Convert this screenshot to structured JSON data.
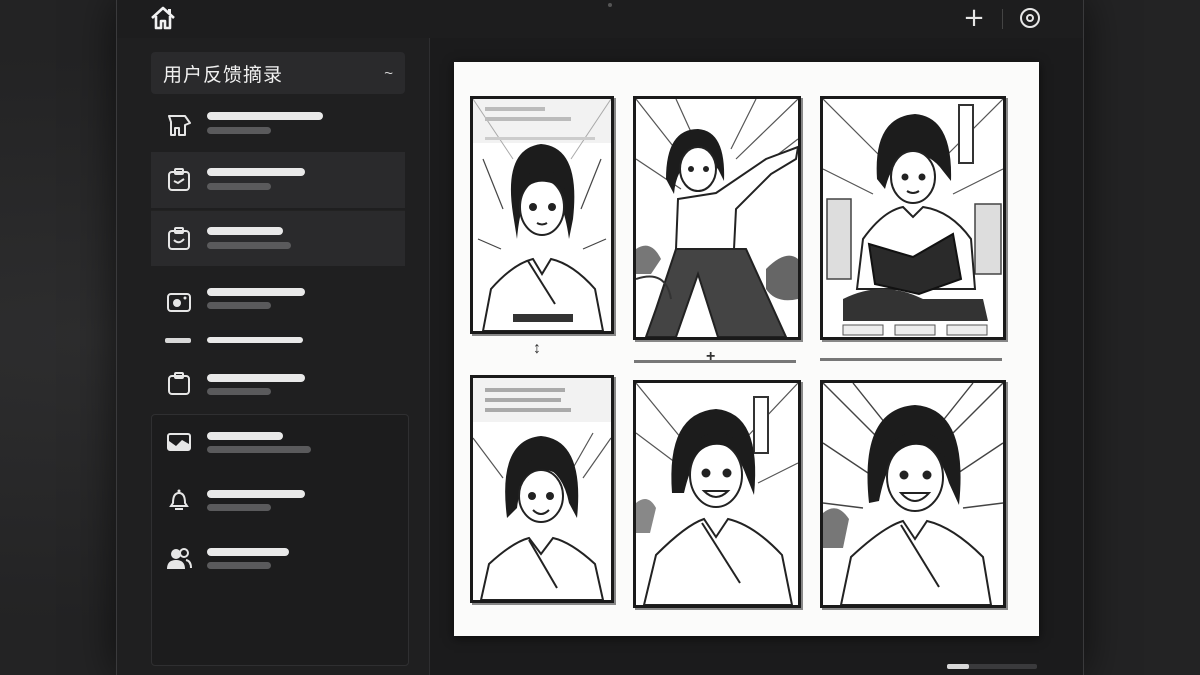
{
  "sidebar": {
    "section_title": "用户反馈摘录",
    "collapse_symbol": "~"
  },
  "topbar": {
    "icons": [
      "home-icon",
      "add-icon",
      "settings-icon"
    ],
    "add_symbol": "+"
  },
  "main": {
    "page_description_icons": [
      "storyboard-panel"
    ],
    "connector_symbol": "↕",
    "connector_plus_symbol": "+"
  },
  "colors": {
    "window_bg": "#1d1d1e",
    "sidebar_bg": "#1f1f20",
    "selected_bg": "#2a2a2c",
    "page_bg": "#fbfbfa",
    "text_primary": "#f0f0f0",
    "placeholder_light": "#e9e9e9",
    "placeholder_dark": "#5a5a5c"
  }
}
